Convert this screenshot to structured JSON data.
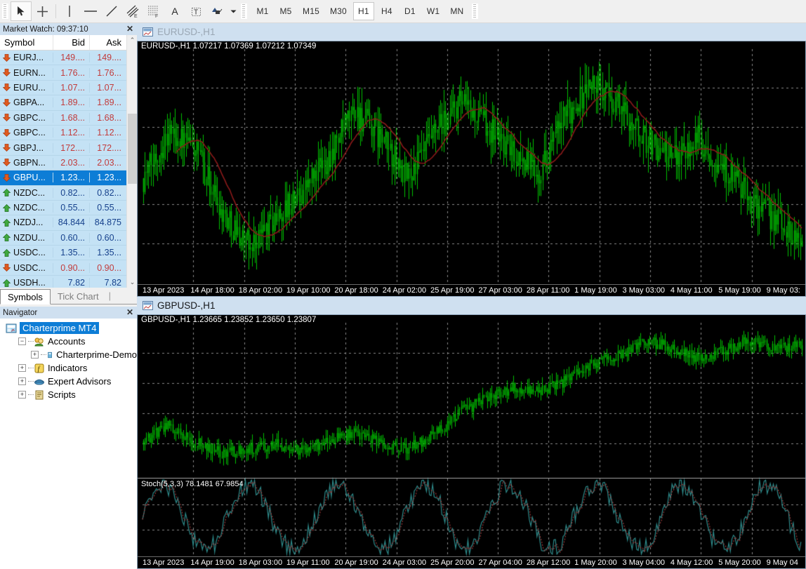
{
  "toolbar": {
    "tools": [
      {
        "name": "cursor-tool",
        "glyph": "arrow",
        "selected": true
      },
      {
        "name": "crosshair-tool",
        "glyph": "cross",
        "selected": false
      },
      {
        "name": "vertical-line-tool",
        "glyph": "vline",
        "selected": false
      },
      {
        "name": "horizontal-line-tool",
        "glyph": "hline",
        "selected": false
      },
      {
        "name": "trendline-tool",
        "glyph": "diag",
        "selected": false
      },
      {
        "name": "equidistant-channel-tool",
        "glyph": "chanE",
        "selected": false
      },
      {
        "name": "fibonacci-retracement-tool",
        "glyph": "fib",
        "selected": false
      },
      {
        "name": "text-tool",
        "glyph": "A",
        "selected": false
      },
      {
        "name": "text-label-tool",
        "glyph": "T",
        "selected": false
      },
      {
        "name": "shapes-tool",
        "glyph": "shapes",
        "selected": false
      }
    ],
    "timeframes": [
      {
        "label": "M1",
        "active": false
      },
      {
        "label": "M5",
        "active": false
      },
      {
        "label": "M15",
        "active": false
      },
      {
        "label": "M30",
        "active": false
      },
      {
        "label": "H1",
        "active": true
      },
      {
        "label": "H4",
        "active": false
      },
      {
        "label": "D1",
        "active": false
      },
      {
        "label": "W1",
        "active": false
      },
      {
        "label": "MN",
        "active": false
      }
    ]
  },
  "market_watch": {
    "title": "Market Watch: 09:37:10",
    "close_label": "✕",
    "columns": [
      "Symbol",
      "Bid",
      "Ask"
    ],
    "rows": [
      {
        "symbol": "EURJ...",
        "bid": "149....",
        "ask": "149....",
        "dir": "down",
        "selected": false
      },
      {
        "symbol": "EURN...",
        "bid": "1.76...",
        "ask": "1.76...",
        "dir": "down",
        "selected": false
      },
      {
        "symbol": "EURU...",
        "bid": "1.07...",
        "ask": "1.07...",
        "dir": "down",
        "selected": false
      },
      {
        "symbol": "GBPA...",
        "bid": "1.89...",
        "ask": "1.89...",
        "dir": "down",
        "selected": false
      },
      {
        "symbol": "GBPC...",
        "bid": "1.68...",
        "ask": "1.68...",
        "dir": "down",
        "selected": false
      },
      {
        "symbol": "GBPC...",
        "bid": "1.12...",
        "ask": "1.12...",
        "dir": "down",
        "selected": false
      },
      {
        "symbol": "GBPJ...",
        "bid": "172....",
        "ask": "172....",
        "dir": "down",
        "selected": false
      },
      {
        "symbol": "GBPN...",
        "bid": "2.03...",
        "ask": "2.03...",
        "dir": "down",
        "selected": false
      },
      {
        "symbol": "GBPU...",
        "bid": "1.23...",
        "ask": "1.23...",
        "dir": "down",
        "selected": true
      },
      {
        "symbol": "NZDC...",
        "bid": "0.82...",
        "ask": "0.82...",
        "dir": "up",
        "selected": false
      },
      {
        "symbol": "NZDC...",
        "bid": "0.55...",
        "ask": "0.55...",
        "dir": "up",
        "selected": false
      },
      {
        "symbol": "NZDJ...",
        "bid": "84.844",
        "ask": "84.875",
        "dir": "up",
        "selected": false
      },
      {
        "symbol": "NZDU...",
        "bid": "0.60...",
        "ask": "0.60...",
        "dir": "up",
        "selected": false
      },
      {
        "symbol": "USDC...",
        "bid": "1.35...",
        "ask": "1.35...",
        "dir": "up",
        "selected": false
      },
      {
        "symbol": "USDC...",
        "bid": "0.90...",
        "ask": "0.90...",
        "dir": "down",
        "selected": false
      },
      {
        "symbol": "USDH...",
        "bid": "7.82",
        "ask": "7.82",
        "dir": "up",
        "selected": false
      }
    ],
    "tabs": [
      {
        "label": "Symbols",
        "active": true
      },
      {
        "label": "Tick Chart",
        "active": false
      }
    ],
    "scroll_up": "⌃",
    "scroll_down": "⌄"
  },
  "navigator": {
    "title": "Navigator",
    "close_label": "✕",
    "items": [
      {
        "label": "Charterprime MT4",
        "level": 0,
        "expander": "",
        "icon": "terminal-icon",
        "selected": true
      },
      {
        "label": "Accounts",
        "level": 1,
        "expander": "−",
        "icon": "accounts-icon",
        "selected": false
      },
      {
        "label": "Charterprime-Demo",
        "level": 2,
        "expander": "+",
        "icon": "account-icon",
        "selected": false
      },
      {
        "label": "Indicators",
        "level": 1,
        "expander": "+",
        "icon": "indicator-icon",
        "selected": false
      },
      {
        "label": "Expert Advisors",
        "level": 1,
        "expander": "+",
        "icon": "expert-icon",
        "selected": false
      },
      {
        "label": "Scripts",
        "level": 1,
        "expander": "+",
        "icon": "script-icon",
        "selected": false
      }
    ]
  },
  "charts": [
    {
      "window_title": "EURUSD-,H1",
      "active": false,
      "ohlc_label": "EURUSD-,H1  1.07217 1.07369 1.07212 1.07349",
      "symbol": "EURUSD-",
      "timeframe": "H1",
      "open": "1.07217",
      "high": "1.07369",
      "low": "1.07212",
      "close": "1.07349",
      "time_labels": [
        "13 Apr 2023",
        "14 Apr 18:00",
        "18 Apr 02:00",
        "19 Apr 10:00",
        "20 Apr 18:00",
        "24 Apr 02:00",
        "25 Apr 19:00",
        "27 Apr 03:00",
        "28 Apr 11:00",
        "1 May 19:00",
        "3 May 03:00",
        "4 May 11:00",
        "5 May 19:00",
        "9 May 03:"
      ],
      "indicators": [
        {
          "name": "Moving Average",
          "color": "#8b1a1a"
        }
      ],
      "candle_color": "#00c000",
      "background": "#000000",
      "grid_color": "#7a7a7a"
    },
    {
      "window_title": "GBPUSD-,H1",
      "active": true,
      "ohlc_label": "GBPUSD-,H1  1.23665 1.23852 1.23650 1.23807",
      "symbol": "GBPUSD-",
      "timeframe": "H1",
      "open": "1.23665",
      "high": "1.23852",
      "low": "1.23650",
      "close": "1.23807",
      "time_labels": [
        "13 Apr 2023",
        "14 Apr 19:00",
        "18 Apr 03:00",
        "19 Apr 11:00",
        "20 Apr 19:00",
        "24 Apr 03:00",
        "25 Apr 20:00",
        "27 Apr 04:00",
        "28 Apr 12:00",
        "1 May 20:00",
        "3 May 04:00",
        "4 May 12:00",
        "5 May 20:00",
        "9 May 04"
      ],
      "subwindow": {
        "label": "Stoch(5,3,3) 78.1481 67.9854",
        "indicator": "Stochastic Oscillator",
        "params": "5,3,3",
        "main_value": "78.1481",
        "signal_value": "67.9854",
        "main_color": "#2e8b8b",
        "signal_color": "#9e3b3b"
      },
      "candle_color": "#00c000",
      "background": "#000000",
      "grid_color": "#7a7a7a"
    }
  ],
  "colors": {
    "title_bar": "#cfe0f0",
    "selection": "#0d7dd6",
    "mdi_background": "#6e8ba8",
    "quote_up": "#16418c",
    "quote_down": "#c23b3b",
    "chart_bg": "#000000",
    "candle": "#00c000"
  }
}
